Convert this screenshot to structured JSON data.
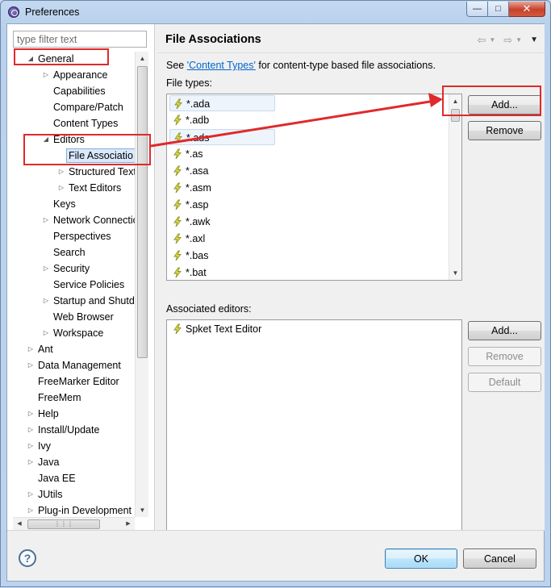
{
  "window": {
    "title": "Preferences"
  },
  "filter": {
    "placeholder": "type filter text"
  },
  "tree": [
    {
      "label": "General",
      "depth": 0,
      "expander": "open"
    },
    {
      "label": "Appearance",
      "depth": 1,
      "expander": "closed"
    },
    {
      "label": "Capabilities",
      "depth": 1,
      "expander": "none"
    },
    {
      "label": "Compare/Patch",
      "depth": 1,
      "expander": "none"
    },
    {
      "label": "Content Types",
      "depth": 1,
      "expander": "none"
    },
    {
      "label": "Editors",
      "depth": 1,
      "expander": "open"
    },
    {
      "label": "File Associatio",
      "depth": 2,
      "expander": "none",
      "selected": true
    },
    {
      "label": "Structured Text",
      "depth": 2,
      "expander": "closed"
    },
    {
      "label": "Text Editors",
      "depth": 2,
      "expander": "closed"
    },
    {
      "label": "Keys",
      "depth": 1,
      "expander": "none"
    },
    {
      "label": "Network Connectio",
      "depth": 1,
      "expander": "closed"
    },
    {
      "label": "Perspectives",
      "depth": 1,
      "expander": "none"
    },
    {
      "label": "Search",
      "depth": 1,
      "expander": "none"
    },
    {
      "label": "Security",
      "depth": 1,
      "expander": "closed"
    },
    {
      "label": "Service Policies",
      "depth": 1,
      "expander": "none"
    },
    {
      "label": "Startup and Shutd",
      "depth": 1,
      "expander": "closed"
    },
    {
      "label": "Web Browser",
      "depth": 1,
      "expander": "none"
    },
    {
      "label": "Workspace",
      "depth": 1,
      "expander": "closed"
    },
    {
      "label": "Ant",
      "depth": 0,
      "expander": "closed"
    },
    {
      "label": "Data Management",
      "depth": 0,
      "expander": "closed"
    },
    {
      "label": "FreeMarker Editor",
      "depth": 0,
      "expander": "none"
    },
    {
      "label": "FreeMem",
      "depth": 0,
      "expander": "none"
    },
    {
      "label": "Help",
      "depth": 0,
      "expander": "closed"
    },
    {
      "label": "Install/Update",
      "depth": 0,
      "expander": "closed"
    },
    {
      "label": "Ivy",
      "depth": 0,
      "expander": "closed"
    },
    {
      "label": "Java",
      "depth": 0,
      "expander": "closed"
    },
    {
      "label": "Java EE",
      "depth": 0,
      "expander": "none"
    },
    {
      "label": "JUtils",
      "depth": 0,
      "expander": "closed"
    },
    {
      "label": "Plug-in Development",
      "depth": 0,
      "expander": "closed"
    }
  ],
  "page": {
    "title": "File Associations",
    "see_prefix": "See ",
    "see_link": "'Content Types'",
    "see_suffix": " for content-type based file associations.",
    "file_types_label": "File types:",
    "file_types": [
      "*.ada",
      "*.adb",
      "*.ads",
      "*.as",
      "*.asa",
      "*.asm",
      "*.asp",
      "*.awk",
      "*.axl",
      "*.bas",
      "*.bat"
    ],
    "associated_label": "Associated editors:",
    "associated_editors": [
      "Spket Text Editor"
    ],
    "add_label": "Add...",
    "remove_label": "Remove",
    "add2_label": "Add...",
    "remove2_label": "Remove",
    "default_label": "Default"
  },
  "footer": {
    "ok_label": "OK",
    "cancel_label": "Cancel",
    "help_glyph": "?"
  },
  "icons": {
    "file_type": "lightning-file-icon",
    "nav_back": "back-arrow-icon",
    "nav_forward": "forward-arrow-icon",
    "help": "help-icon"
  },
  "colors": {
    "annotation": "#e0292a",
    "link": "#0066cc",
    "selection": "#d9e8fb"
  }
}
